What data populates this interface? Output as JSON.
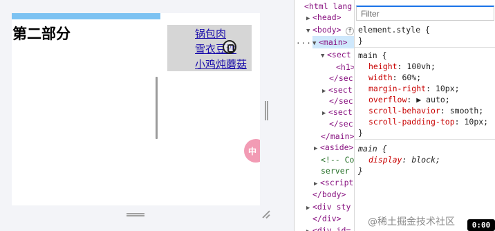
{
  "preview": {
    "progress_fraction": 0.6,
    "section_heading": "第二部分",
    "aside_links": [
      "锅包肉",
      "雪衣豆沙",
      "小鸡炖蘑菇"
    ],
    "float_avatar_text": "中"
  },
  "dom_tree": {
    "lines": [
      {
        "text": "<html lang",
        "class": "tag"
      },
      {
        "text": "<head>",
        "class": "tag"
      },
      {
        "text": "<body>",
        "class": "tag"
      },
      {
        "text": "<main>",
        "class": "tag"
      },
      {
        "text": "<sect",
        "class": "tag"
      },
      {
        "text": "<h1>",
        "class": "tag"
      },
      {
        "text": "</sec",
        "class": "tag"
      },
      {
        "text": "<sect",
        "class": "tag"
      },
      {
        "text": "</sec",
        "class": "tag"
      },
      {
        "text": "<sect",
        "class": "tag"
      },
      {
        "text": "</sec",
        "class": "tag"
      },
      {
        "text": "</main>",
        "class": "tag"
      },
      {
        "text": "<aside>",
        "class": "tag"
      },
      {
        "text": "<!-- Co",
        "class": "comment"
      },
      {
        "text": "server",
        "class": "comment"
      },
      {
        "text": "<script",
        "class": "tag"
      },
      {
        "text": "</body>",
        "class": "tag"
      },
      {
        "text": "<div sty",
        "class": "tag"
      },
      {
        "text": "</div>",
        "class": "tag"
      },
      {
        "text": "<div id=",
        "class": "tag"
      }
    ],
    "body_badge": "f",
    "dots": "..."
  },
  "styles": {
    "filter_placeholder": "Filter",
    "element_style_selector": "element.style {",
    "close_brace": "}",
    "main_rule_selector": "main {",
    "main_rule_props": [
      {
        "name": "height",
        "value": "100vh;"
      },
      {
        "name": "width",
        "value": "60%;"
      },
      {
        "name": "margin-right",
        "value": "10px;"
      },
      {
        "name": "overflow",
        "value": "▶ auto;"
      },
      {
        "name": "scroll-behavior",
        "value": "smooth;"
      },
      {
        "name": "scroll-padding-top",
        "value": "10px;"
      }
    ],
    "ua_rule_selector": "main {",
    "ua_rule_props": [
      {
        "name": "display",
        "value": "block;"
      }
    ]
  },
  "overlay": {
    "watermark": "@稀土掘金技术社区",
    "timecode": "0:00"
  },
  "colors": {
    "progress": "#7cc2f2",
    "aside_bg": "#d6d6d6",
    "link": "#1a0dab",
    "avatar": "#f29bb4"
  }
}
